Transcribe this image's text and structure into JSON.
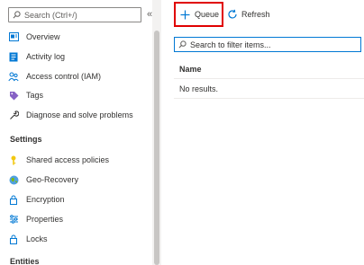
{
  "sidebar": {
    "search_placeholder": "Search (Ctrl+/)",
    "collapse_glyph": "«",
    "items": [
      {
        "label": "Overview",
        "icon": "overview-icon"
      },
      {
        "label": "Activity log",
        "icon": "activity-log-icon"
      },
      {
        "label": "Access control (IAM)",
        "icon": "people-icon"
      },
      {
        "label": "Tags",
        "icon": "tag-icon"
      },
      {
        "label": "Diagnose and solve problems",
        "icon": "wrench-icon"
      }
    ],
    "sections": [
      {
        "title": "Settings",
        "items": [
          {
            "label": "Shared access policies",
            "icon": "key-icon"
          },
          {
            "label": "Geo-Recovery",
            "icon": "globe-icon"
          },
          {
            "label": "Encryption",
            "icon": "lock-icon"
          },
          {
            "label": "Properties",
            "icon": "properties-icon"
          },
          {
            "label": "Locks",
            "icon": "lock-icon"
          }
        ]
      },
      {
        "title": "Entities",
        "items": []
      }
    ]
  },
  "toolbar": {
    "queue_label": "Queue",
    "refresh_label": "Refresh"
  },
  "filter": {
    "placeholder": "Search to filter items..."
  },
  "table": {
    "columns": [
      "Name"
    ],
    "empty_text": "No results."
  },
  "colors": {
    "accent": "#0078d4",
    "highlight_border": "#e00000"
  }
}
